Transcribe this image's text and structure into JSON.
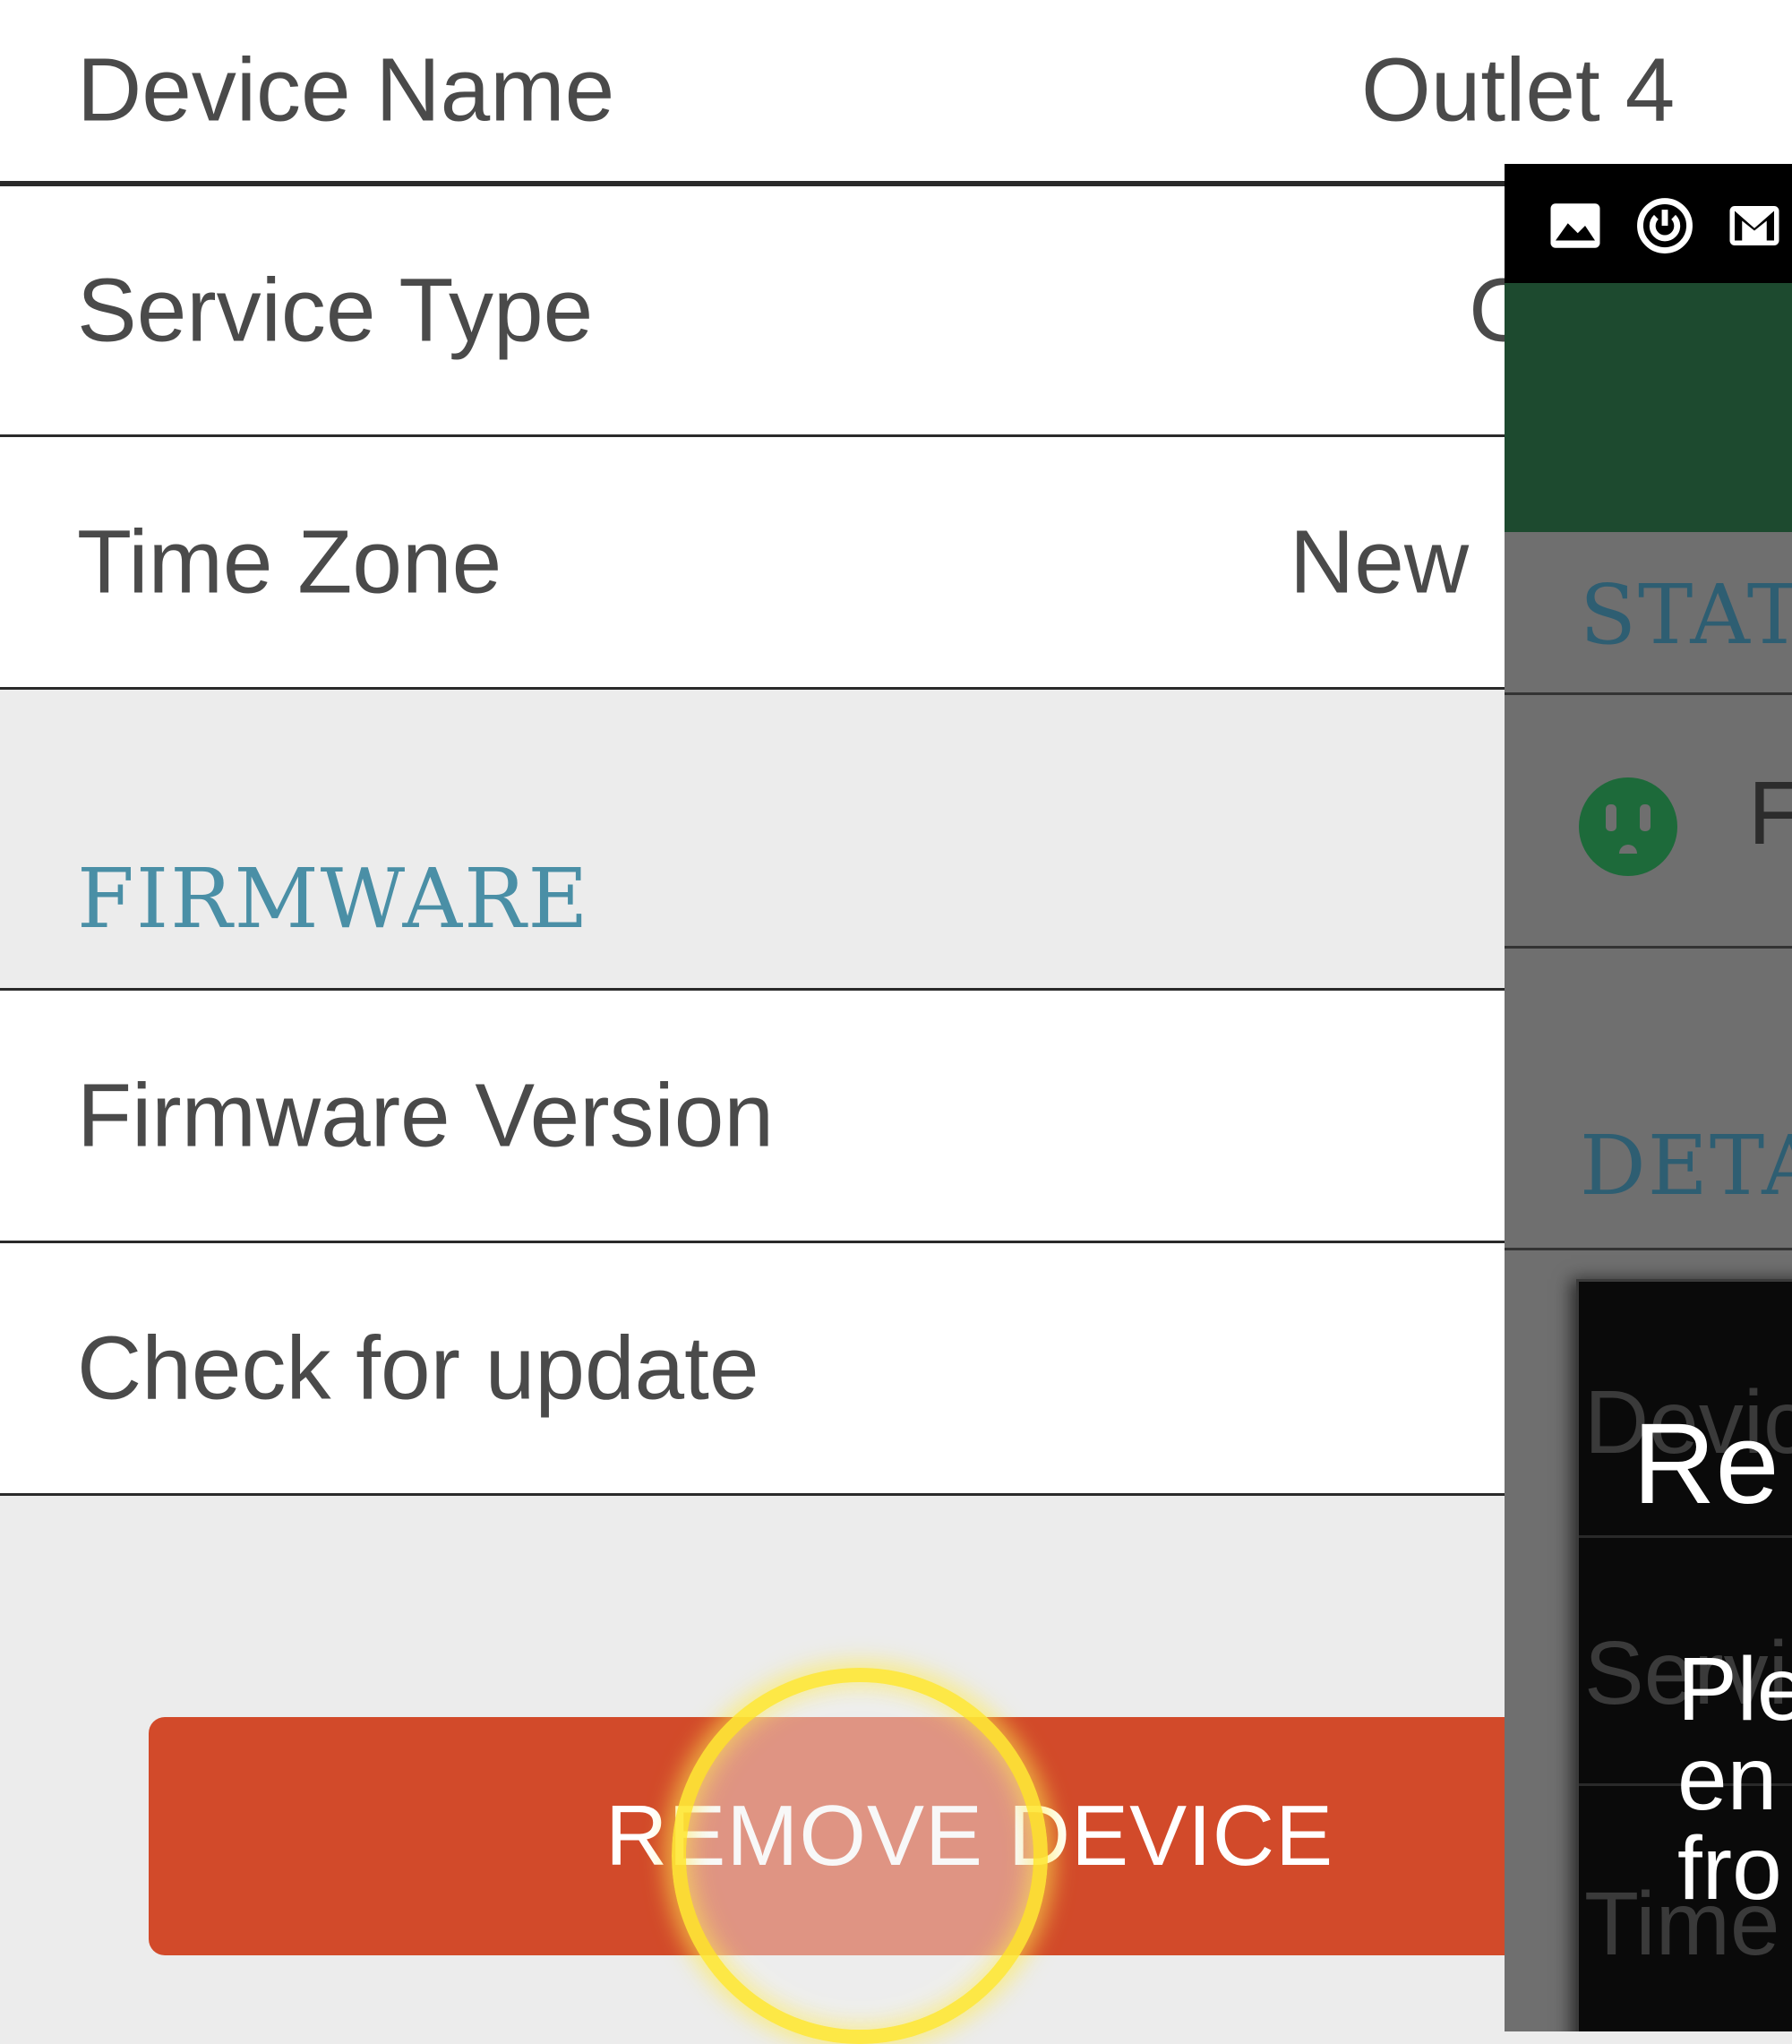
{
  "settings": {
    "device_name": {
      "label": "Device Name",
      "value": "Outlet 4"
    },
    "service_type": {
      "label": "Service Type",
      "value": "C"
    },
    "time_zone": {
      "label": "Time Zone",
      "value": "New"
    },
    "firmware_section": "FIRMWARE",
    "firmware_version": {
      "label": "Firmware Version",
      "value": ""
    },
    "check_update": {
      "label": "Check for update"
    },
    "remove_button": "REMOVE DEVICE"
  },
  "overlay": {
    "section_status": "STAT",
    "section_details": "DETA",
    "outlet_text": "F",
    "ghost_device": "Devic",
    "ghost_service": "Servi",
    "ghost_time": "Time",
    "dialog_title": "Re",
    "dialog_lines": [
      "Ple",
      "en",
      "fro"
    ]
  },
  "colors": {
    "accent_header": "#4a8fa6",
    "danger_button": "#d24a2a",
    "app_bar_green": "#1d4a2f"
  }
}
